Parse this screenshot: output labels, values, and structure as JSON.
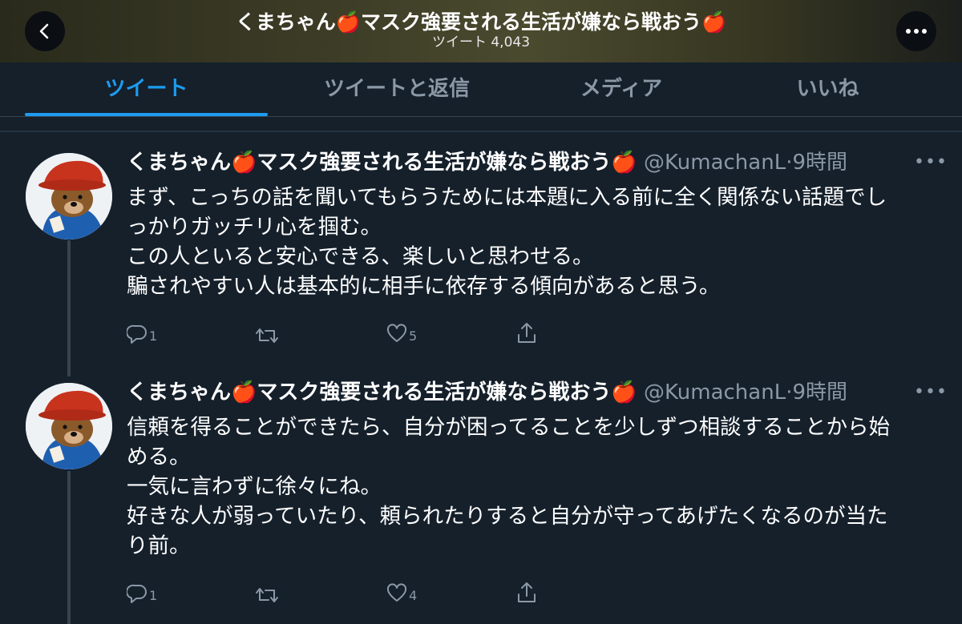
{
  "header": {
    "title": "くまちゃん🍎マスク強要される生活が嫌なら戦おう🍎",
    "subtitle": "ツイート 4,043"
  },
  "tabs": [
    {
      "label": "ツイート",
      "active": true
    },
    {
      "label": "ツイートと返信",
      "active": false
    },
    {
      "label": "メディア",
      "active": false
    },
    {
      "label": "いいね",
      "active": false
    }
  ],
  "tweets": [
    {
      "author_name": "くまちゃん🍎マスク強要される生活が嫌なら戦おう🍎",
      "handle": "@KumachanL",
      "time": "9時間",
      "lines": [
        "まず、こっちの話を聞いてもらうためには本題に入る前に全く関係ない話題でし",
        "っかりガッチリ心を掴む。",
        "この人といると安心できる、楽しいと思わせる。",
        "騙されやすい人は基本的に相手に依存する傾向があると思う。"
      ],
      "replies": "1",
      "retweets": "",
      "likes": "5"
    },
    {
      "author_name": "くまちゃん🍎マスク強要される生活が嫌なら戦おう🍎",
      "handle": "@KumachanL",
      "time": "9時間",
      "lines": [
        "信頼を得ることができたら、自分が困ってることを少しずつ相談することから始",
        "める。",
        "一気に言わずに徐々にね。",
        "好きな人が弱っていたり、頼られたりすると自分が守ってあげたくなるのが当た",
        "り前。"
      ],
      "replies": "1",
      "retweets": "",
      "likes": "4"
    }
  ],
  "colors": {
    "background": "#15202b",
    "accent": "#1d9bf0",
    "muted": "#8b98a5"
  },
  "icons": {
    "back": "chevron-left-icon",
    "more": "more-dots-icon",
    "reply": "reply-icon",
    "retweet": "retweet-icon",
    "like": "heart-icon",
    "share": "share-icon"
  }
}
